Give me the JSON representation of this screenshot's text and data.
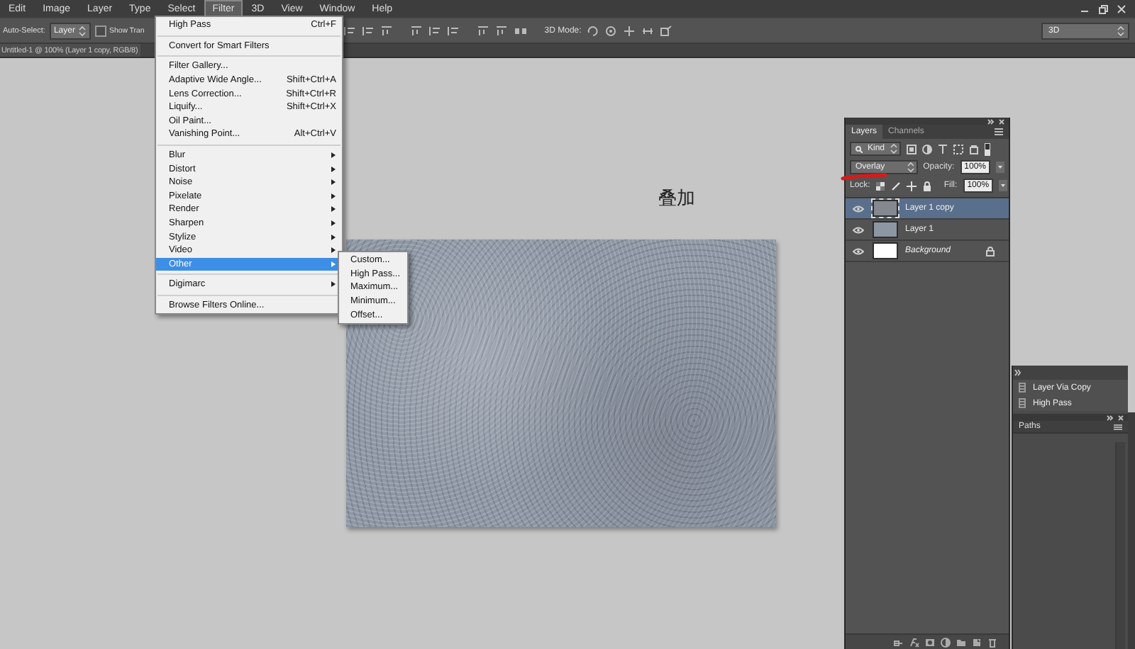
{
  "menu_bar": {
    "items": [
      {
        "label": "Edit",
        "selected": false
      },
      {
        "label": "Image",
        "selected": false
      },
      {
        "label": "Layer",
        "selected": false
      },
      {
        "label": "Type",
        "selected": false
      },
      {
        "label": "Select",
        "selected": false
      },
      {
        "label": "Filter",
        "selected": true
      },
      {
        "label": "3D",
        "selected": false
      },
      {
        "label": "View",
        "selected": false
      },
      {
        "label": "Window",
        "selected": false
      },
      {
        "label": "Help",
        "selected": false
      }
    ]
  },
  "options_bar": {
    "auto_select_label": "Auto-Select:",
    "auto_select_value": "Layer",
    "show_transform": {
      "label": "Show Tran",
      "checked": false
    },
    "mode_label": "3D Mode:",
    "workspace": "3D"
  },
  "document_tab": {
    "title": "Untitled-1 @ 100% (Layer 1 copy, RGB/8)"
  },
  "canvas": {
    "annotation": "叠加"
  },
  "filter_menu": {
    "items": [
      {
        "kind": "item",
        "label": "High Pass",
        "shortcut": "Ctrl+F",
        "submenu": false,
        "selected": false
      },
      {
        "kind": "separator"
      },
      {
        "kind": "item",
        "label": "Convert for Smart Filters",
        "submenu": false,
        "selected": false
      },
      {
        "kind": "separator"
      },
      {
        "kind": "item",
        "label": "Filter Gallery...",
        "submenu": false,
        "selected": false
      },
      {
        "kind": "item",
        "label": "Adaptive Wide Angle...",
        "shortcut": "Shift+Ctrl+A",
        "submenu": false,
        "selected": false
      },
      {
        "kind": "item",
        "label": "Lens Correction...",
        "shortcut": "Shift+Ctrl+R",
        "submenu": false,
        "selected": false
      },
      {
        "kind": "item",
        "label": "Liquify...",
        "shortcut": "Shift+Ctrl+X",
        "submenu": false,
        "selected": false
      },
      {
        "kind": "item",
        "label": "Oil Paint...",
        "submenu": false,
        "selected": false
      },
      {
        "kind": "item",
        "label": "Vanishing Point...",
        "shortcut": "Alt+Ctrl+V",
        "submenu": false,
        "selected": false
      },
      {
        "kind": "separator"
      },
      {
        "kind": "item",
        "label": "Blur",
        "submenu": true,
        "selected": false
      },
      {
        "kind": "item",
        "label": "Distort",
        "submenu": true,
        "selected": false
      },
      {
        "kind": "item",
        "label": "Noise",
        "submenu": true,
        "selected": false
      },
      {
        "kind": "item",
        "label": "Pixelate",
        "submenu": true,
        "selected": false
      },
      {
        "kind": "item",
        "label": "Render",
        "submenu": true,
        "selected": false
      },
      {
        "kind": "item",
        "label": "Sharpen",
        "submenu": true,
        "selected": false
      },
      {
        "kind": "item",
        "label": "Stylize",
        "submenu": true,
        "selected": false
      },
      {
        "kind": "item",
        "label": "Video",
        "submenu": true,
        "selected": false
      },
      {
        "kind": "item",
        "label": "Other",
        "submenu": true,
        "selected": true
      },
      {
        "kind": "separator"
      },
      {
        "kind": "item",
        "label": "Digimarc",
        "submenu": true,
        "selected": false
      },
      {
        "kind": "separator"
      },
      {
        "kind": "item",
        "label": "Browse Filters Online...",
        "submenu": false,
        "selected": false
      }
    ]
  },
  "other_submenu": {
    "items": [
      "Custom...",
      "High Pass...",
      "Maximum...",
      "Minimum...",
      "Offset..."
    ]
  },
  "layers_panel": {
    "tabs": [
      {
        "label": "Layers",
        "selected": true
      },
      {
        "label": "Channels",
        "selected": false
      }
    ],
    "filter_kind": "Kind",
    "blend_mode": "Overlay",
    "opacity_label": "Opacity:",
    "opacity": "100%",
    "lock_label": "Lock:",
    "fill_label": "Fill:",
    "fill": "100%",
    "layers": [
      {
        "name": "Layer 1 copy",
        "selected": true,
        "visible": true,
        "locked": false,
        "color": "#85898f"
      },
      {
        "name": "Layer 1",
        "selected": false,
        "visible": true,
        "locked": false,
        "color": "#8d96a3"
      },
      {
        "name": "Background",
        "selected": false,
        "visible": true,
        "locked": true,
        "color": "#ffffff"
      }
    ]
  },
  "history_panel": {
    "items": [
      {
        "label": "Layer Via Copy",
        "selected": false
      },
      {
        "label": "High Pass",
        "selected": false
      }
    ]
  },
  "paths_panel": {
    "tab": "Paths"
  }
}
